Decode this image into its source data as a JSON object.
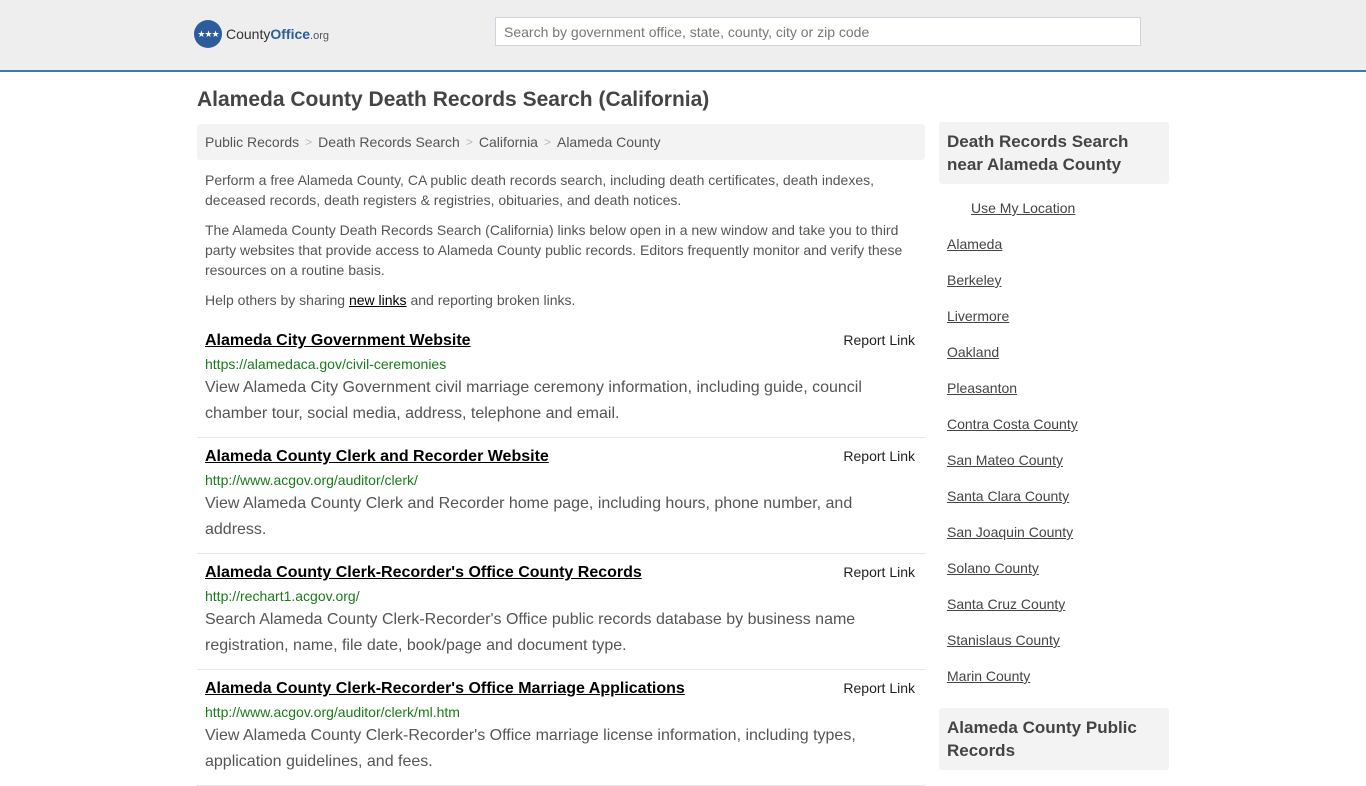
{
  "header": {
    "logo": {
      "county": "County",
      "office": "Office",
      "tld": ".org"
    },
    "search_placeholder": "Search by government office, state, county, city or zip code"
  },
  "page_title": "Alameda County Death Records Search (California)",
  "breadcrumb": [
    "Public Records",
    "Death Records Search",
    "California",
    "Alameda County"
  ],
  "intro": {
    "p1": "Perform a free Alameda County, CA public death records search, including death certificates, death indexes, deceased records, death registers & registries, obituaries, and death notices.",
    "p2": "The Alameda County Death Records Search (California) links below open in a new window and take you to third party websites that provide access to Alameda County public records. Editors frequently monitor and verify these resources on a routine basis.",
    "p3_before": "Help others by sharing ",
    "p3_link": "new links",
    "p3_after": " and reporting broken links."
  },
  "report_label": "Report Link",
  "listings": [
    {
      "title": "Alameda City Government Website",
      "url": "https://alamedaca.gov/civil-ceremonies",
      "desc": "View Alameda City Government civil marriage ceremony information, including guide, council chamber tour, social media, address, telephone and email."
    },
    {
      "title": "Alameda County Clerk and Recorder Website",
      "url": "http://www.acgov.org/auditor/clerk/",
      "desc": "View Alameda County Clerk and Recorder home page, including hours, phone number, and address."
    },
    {
      "title": "Alameda County Clerk-Recorder's Office County Records",
      "url": "http://rechart1.acgov.org/",
      "desc": "Search Alameda County Clerk-Recorder's Office public records database by business name registration, name, file date, book/page and document type."
    },
    {
      "title": "Alameda County Clerk-Recorder's Office Marriage Applications",
      "url": "http://www.acgov.org/auditor/clerk/ml.htm",
      "desc": "View Alameda County Clerk-Recorder's Office marriage license information, including types, application guidelines, and fees."
    }
  ],
  "sidebar": {
    "heading": "Death Records Search near Alameda County",
    "use_location": "Use My Location",
    "links": [
      "Alameda",
      "Berkeley",
      "Livermore",
      "Oakland",
      "Pleasanton",
      "Contra Costa County",
      "San Mateo County",
      "Santa Clara County",
      "San Joaquin County",
      "Solano County",
      "Santa Cruz County",
      "Stanislaus County",
      "Marin County"
    ],
    "heading2": "Alameda County Public Records"
  }
}
